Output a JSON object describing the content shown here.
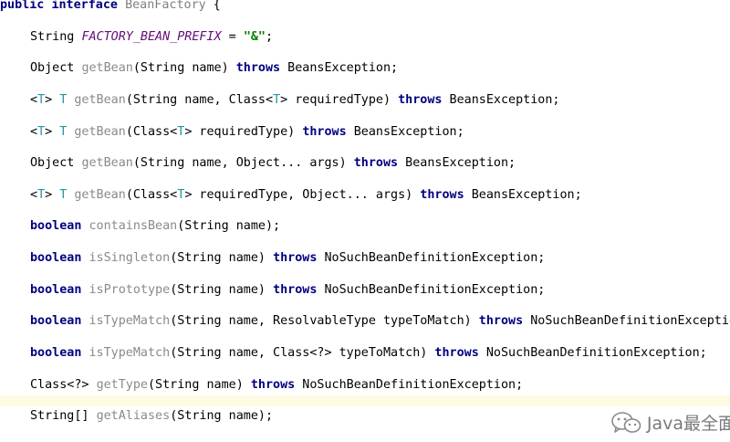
{
  "code": {
    "l0": {
      "kw1": "public",
      "kw2": "interface",
      "name": "BeanFactory",
      "brace": " {"
    },
    "l1": {
      "type": "String ",
      "const": "FACTORY_BEAN_PREFIX",
      "eq": " = ",
      "str": "\"&\"",
      "end": ";"
    },
    "l2": {
      "ret": "Object ",
      "m": "getBean",
      "params": "(String name) ",
      "kw": "throws",
      "exc": " BeansException;"
    },
    "l3": {
      "lt": "<",
      "t1": "T",
      "gt": "> ",
      "t2": "T",
      "sp": " ",
      "m": "getBean",
      "p1": "(String name, Class<",
      "t3": "T",
      "p2": "> requiredType) ",
      "kw": "throws",
      "exc": " BeansException;"
    },
    "l4": {
      "lt": "<",
      "t1": "T",
      "gt": "> ",
      "t2": "T",
      "sp": " ",
      "m": "getBean",
      "p1": "(Class<",
      "t3": "T",
      "p2": "> requiredType) ",
      "kw": "throws",
      "exc": " BeansException;"
    },
    "l5": {
      "ret": "Object ",
      "m": "getBean",
      "params": "(String name, Object... args) ",
      "kw": "throws",
      "exc": " BeansException;"
    },
    "l6": {
      "lt": "<",
      "t1": "T",
      "gt": "> ",
      "t2": "T",
      "sp": " ",
      "m": "getBean",
      "p1": "(Class<",
      "t3": "T",
      "p2": "> requiredType, Object... args) ",
      "kw": "throws",
      "exc": " BeansException;"
    },
    "l7": {
      "kw0": "boolean",
      "sp": " ",
      "m": "containsBean",
      "params": "(String name);"
    },
    "l8": {
      "kw0": "boolean",
      "sp": " ",
      "m": "isSingleton",
      "params": "(String name) ",
      "kw": "throws",
      "exc": " NoSuchBeanDefinitionException;"
    },
    "l9": {
      "kw0": "boolean",
      "sp": " ",
      "m": "isPrototype",
      "params": "(String name) ",
      "kw": "throws",
      "exc": " NoSuchBeanDefinitionException;"
    },
    "l10": {
      "kw0": "boolean",
      "sp": " ",
      "m": "isTypeMatch",
      "params": "(String name, ResolvableType typeToMatch) ",
      "kw": "throws",
      "exc": " NoSuchBeanDefinitionException;"
    },
    "l11": {
      "kw0": "boolean",
      "sp": " ",
      "m": "isTypeMatch",
      "params": "(String name, Class<?> typeToMatch) ",
      "kw": "throws",
      "exc": " NoSuchBeanDefinitionException;"
    },
    "l12": {
      "ret": "Class<?> ",
      "m": "getType",
      "params": "(String name) ",
      "kw": "throws",
      "exc": " NoSuchBeanDefinitionException;"
    },
    "l13": {
      "ret": "String[] ",
      "m": "getAliases",
      "params": "(String name);"
    }
  },
  "watermark": {
    "text": "Java最全面",
    "icon": "wechat-icon"
  },
  "colors": {
    "keyword": "#000080",
    "method": "#8a8a8a",
    "type_param": "#20999d",
    "constant": "#660e7a",
    "string": "#008000",
    "current_line": "#fffae3"
  }
}
